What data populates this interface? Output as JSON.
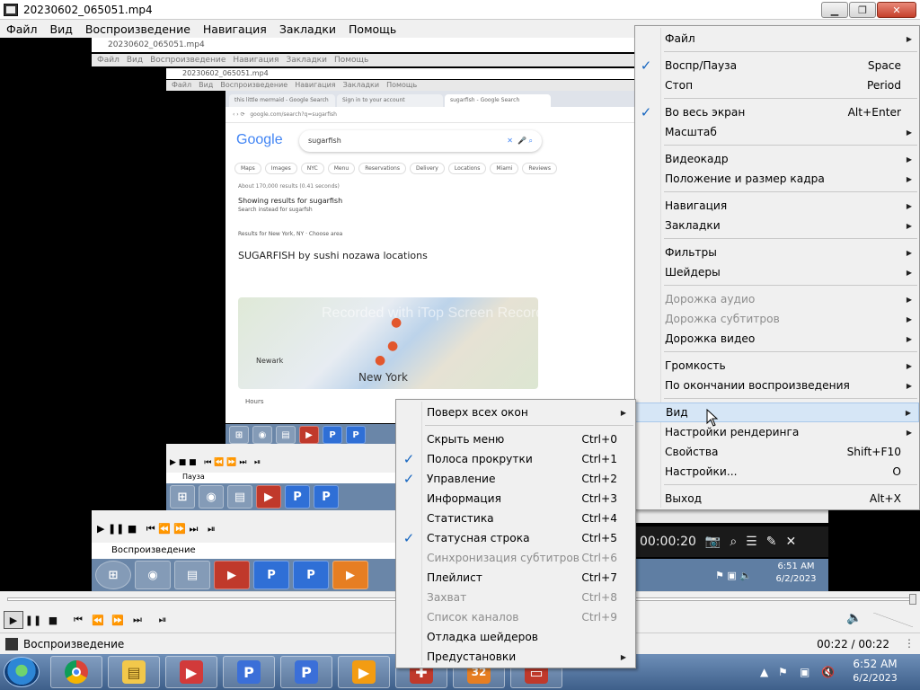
{
  "window": {
    "title": "20230602_065051.mp4",
    "minimize": "▁",
    "maximize": "❐",
    "close": "✕"
  },
  "menubar": [
    "Файл",
    "Вид",
    "Воспроизведение",
    "Навигация",
    "Закладки",
    "Помощь"
  ],
  "nested": {
    "title1": "20230602_065051.mp4",
    "menu1": [
      "Файл",
      "Вид",
      "Воспроизведение",
      "Навигация",
      "Закладки",
      "Помощь"
    ],
    "title2": "20230602_065051.mp4",
    "menu2": [
      "Файл",
      "Вид",
      "Воспроизведение",
      "Навигация",
      "Закладки",
      "Помощь"
    ],
    "browser": {
      "tabs": [
        "this little mermaid - Google Search",
        "Sign in to your account",
        "sugarfish - Google Search"
      ],
      "search_query": "sugarfish",
      "logo": "Google",
      "chips": [
        "Maps",
        "Images",
        "NYC",
        "Menu",
        "Reservations",
        "Delivery",
        "Locations",
        "Miami",
        "Reviews"
      ],
      "results_count": "About 170,000 results (0.41 seconds)",
      "showing_for": "Showing results for sugarfish",
      "search_instead": "Search instead for sugarfsh",
      "results_for": "Results for New York, NY · Choose area",
      "heading": "SUGARFISH by sushi nozawa locations",
      "map_label": "New York",
      "map_label2": "Newark",
      "hours": "Hours"
    },
    "watermark": [
      "Recorded with iTop Screen Recorder",
      "Recorded with iTop Screen Recorder",
      "Recorded with iTop Screen Recorder"
    ],
    "small_status": "Пауза",
    "playback_label": "Воспроизведение",
    "overlay_time": "00:00:20",
    "clock_small": {
      "time": "6:51 AM",
      "date": "6/2/2023"
    }
  },
  "status": {
    "label": "Воспроизведение",
    "time": "00:22 / 00:22"
  },
  "taskbar": {
    "clock_time": "6:52 AM",
    "clock_date": "6/2/2023",
    "apps": [
      "chrome-icon",
      "file-explorer-icon",
      "screen-recorder-icon",
      "p-app-icon",
      "p-app-icon",
      "media-player-icon",
      "tool-icon",
      "calendar-icon",
      "presentation-icon"
    ],
    "p_letter": "P",
    "cal_day": "32"
  },
  "main_menu": {
    "items": [
      {
        "label": "Файл",
        "shortcut": "",
        "submenu": true,
        "checked": false,
        "disabled": false
      },
      {
        "sep": true
      },
      {
        "label": "Воспр/Пауза",
        "shortcut": "Space",
        "submenu": false,
        "checked": true,
        "disabled": false
      },
      {
        "label": "Стоп",
        "shortcut": "Period",
        "submenu": false,
        "checked": false,
        "disabled": false
      },
      {
        "sep": true
      },
      {
        "label": "Во весь экран",
        "shortcut": "Alt+Enter",
        "submenu": false,
        "checked": true,
        "disabled": false
      },
      {
        "label": "Масштаб",
        "shortcut": "",
        "submenu": true,
        "checked": false,
        "disabled": false
      },
      {
        "sep": true
      },
      {
        "label": "Видеокадр",
        "shortcut": "",
        "submenu": true,
        "checked": false,
        "disabled": false
      },
      {
        "label": "Положение и размер кадра",
        "shortcut": "",
        "submenu": true,
        "checked": false,
        "disabled": false
      },
      {
        "sep": true
      },
      {
        "label": "Навигация",
        "shortcut": "",
        "submenu": true,
        "checked": false,
        "disabled": false
      },
      {
        "label": "Закладки",
        "shortcut": "",
        "submenu": true,
        "checked": false,
        "disabled": false
      },
      {
        "sep": true
      },
      {
        "label": "Фильтры",
        "shortcut": "",
        "submenu": true,
        "checked": false,
        "disabled": false
      },
      {
        "label": "Шейдеры",
        "shortcut": "",
        "submenu": true,
        "checked": false,
        "disabled": false
      },
      {
        "sep": true
      },
      {
        "label": "Дорожка аудио",
        "shortcut": "",
        "submenu": true,
        "checked": false,
        "disabled": true
      },
      {
        "label": "Дорожка субтитров",
        "shortcut": "",
        "submenu": true,
        "checked": false,
        "disabled": true
      },
      {
        "label": "Дорожка видео",
        "shortcut": "",
        "submenu": true,
        "checked": false,
        "disabled": false
      },
      {
        "sep": true
      },
      {
        "label": "Громкость",
        "shortcut": "",
        "submenu": true,
        "checked": false,
        "disabled": false
      },
      {
        "label": "По окончании воспроизведения",
        "shortcut": "",
        "submenu": true,
        "checked": false,
        "disabled": false
      },
      {
        "sep": true
      },
      {
        "label": "Вид",
        "shortcut": "",
        "submenu": true,
        "checked": false,
        "disabled": false,
        "highlighted": true
      },
      {
        "label": "Настройки рендеринга",
        "shortcut": "",
        "submenu": true,
        "checked": false,
        "disabled": false
      },
      {
        "label": "Свойства",
        "shortcut": "Shift+F10",
        "submenu": false,
        "checked": false,
        "disabled": false
      },
      {
        "label": "Настройки...",
        "shortcut": "O",
        "submenu": false,
        "checked": false,
        "disabled": false
      },
      {
        "sep": true
      },
      {
        "label": "Выход",
        "shortcut": "Alt+X",
        "submenu": false,
        "checked": false,
        "disabled": false
      }
    ]
  },
  "view_menu": {
    "items": [
      {
        "label": "Поверх всех окон",
        "shortcut": "",
        "submenu": true,
        "checked": false,
        "disabled": false
      },
      {
        "sep": true
      },
      {
        "label": "Скрыть меню",
        "shortcut": "Ctrl+0",
        "submenu": false,
        "checked": false,
        "disabled": false
      },
      {
        "label": "Полоса прокрутки",
        "shortcut": "Ctrl+1",
        "submenu": false,
        "checked": true,
        "disabled": false
      },
      {
        "label": "Управление",
        "shortcut": "Ctrl+2",
        "submenu": false,
        "checked": true,
        "disabled": false
      },
      {
        "label": "Информация",
        "shortcut": "Ctrl+3",
        "submenu": false,
        "checked": false,
        "disabled": false
      },
      {
        "label": "Статистика",
        "shortcut": "Ctrl+4",
        "submenu": false,
        "checked": false,
        "disabled": false
      },
      {
        "label": "Статусная строка",
        "shortcut": "Ctrl+5",
        "submenu": false,
        "checked": true,
        "disabled": false
      },
      {
        "label": "Синхронизация субтитров",
        "shortcut": "Ctrl+6",
        "submenu": false,
        "checked": false,
        "disabled": true
      },
      {
        "label": "Плейлист",
        "shortcut": "Ctrl+7",
        "submenu": false,
        "checked": false,
        "disabled": false
      },
      {
        "label": "Захват",
        "shortcut": "Ctrl+8",
        "submenu": false,
        "checked": false,
        "disabled": true
      },
      {
        "label": "Список каналов",
        "shortcut": "Ctrl+9",
        "submenu": false,
        "checked": false,
        "disabled": true
      },
      {
        "label": "Отладка шейдеров",
        "shortcut": "",
        "submenu": false,
        "checked": false,
        "disabled": false
      },
      {
        "label": "Предустановки",
        "shortcut": "",
        "submenu": true,
        "checked": false,
        "disabled": false
      }
    ]
  }
}
